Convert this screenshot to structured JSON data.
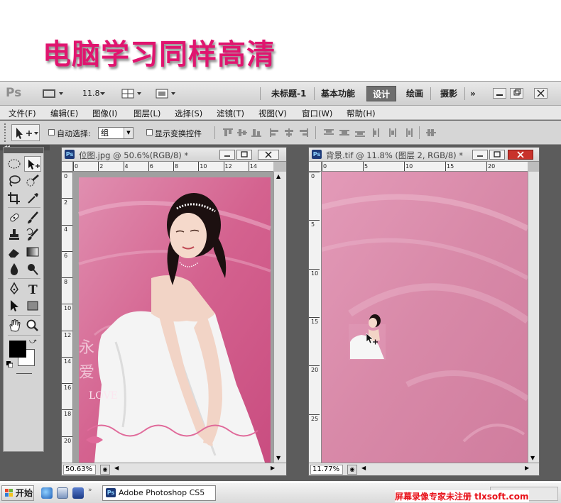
{
  "banner": {
    "text": "电脑学习同样高清"
  },
  "app": {
    "logo": "Ps",
    "zoom_label": "11.8",
    "workspaces": [
      {
        "label": "未标题-1",
        "active": false
      },
      {
        "label": "基本功能",
        "active": false
      },
      {
        "label": "设计",
        "active": true
      },
      {
        "label": "绘画",
        "active": false
      },
      {
        "label": "摄影",
        "active": false
      }
    ],
    "more": "»",
    "window_controls": [
      "minimize-icon",
      "restore-icon",
      "close-icon"
    ]
  },
  "menu": [
    "文件(F)",
    "编辑(E)",
    "图像(I)",
    "图层(L)",
    "选择(S)",
    "滤镜(T)",
    "视图(V)",
    "窗口(W)",
    "帮助(H)"
  ],
  "options": {
    "auto_select_label": "自动选择:",
    "auto_select_value": "组",
    "show_transform_label": "显示变换控件"
  },
  "tools": [
    "marquee-icon",
    "move-icon",
    "lasso-icon",
    "quick-select-icon",
    "crop-icon",
    "eyedropper-icon",
    "healing-icon",
    "brush-icon",
    "stamp-icon",
    "history-brush-icon",
    "eraser-icon",
    "gradient-icon",
    "blur-icon",
    "dodge-icon",
    "pen-icon",
    "type-icon",
    "path-select-icon",
    "rectangle-icon",
    "hand-icon",
    "zoom-icon"
  ],
  "doc1": {
    "title": "位图.jpg @ 50.6%(RGB/8) *",
    "zoom": "50.63%",
    "ruler_h": [
      "0",
      "2",
      "4",
      "6",
      "8",
      "10",
      "12",
      "14"
    ],
    "ruler_v": [
      "0",
      "2",
      "4",
      "6",
      "8",
      "10",
      "12",
      "14",
      "16",
      "18",
      "20"
    ],
    "canvas_text": "LOVE",
    "colors": {
      "bg": "#d8709a",
      "dress": "#f4f4f4"
    }
  },
  "doc2": {
    "title": "背景.tif @ 11.8% (图层 2, RGB/8) *",
    "zoom": "11.77%",
    "ruler_h": [
      "0",
      "5",
      "10",
      "15",
      "20"
    ],
    "ruler_v": [
      "0",
      "5",
      "10",
      "15",
      "20",
      "25"
    ],
    "colors": {
      "bg": "#d98aa8"
    }
  },
  "taskbar": {
    "start_label": "开始",
    "task_label": "Adobe Photoshop CS5",
    "watermark": "屏幕录像专家未注册 tlxsoft.com"
  },
  "accent_color": "#e0156f"
}
